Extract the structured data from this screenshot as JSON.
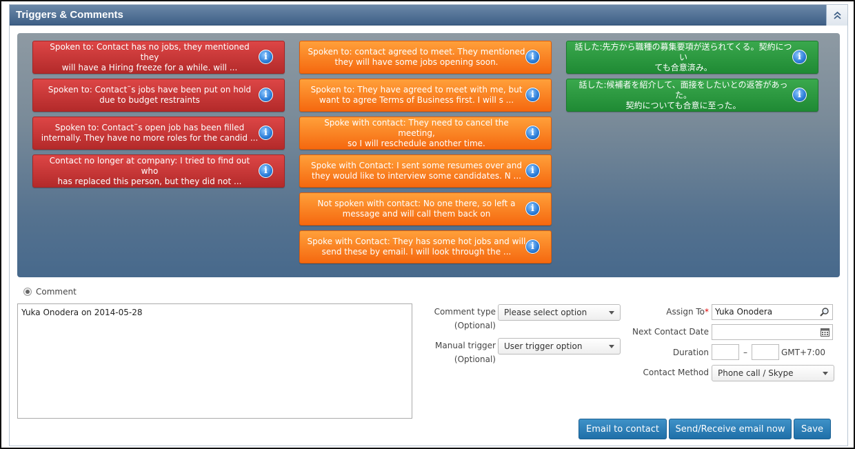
{
  "panel": {
    "title": "Triggers & Comments"
  },
  "triggers": {
    "col1": [
      "Spoken to: Contact has no jobs, they mentioned they\nwill have a Hiring freeze for a while. will ...",
      "Spoken to: Contact¨s jobs have been put on hold\ndue to budget restraints",
      "Spoken to: Contact¨s open job has been filled\ninternally. They have no more roles for the candid ...",
      "Contact no longer at company: I tried to find out who\nhas replaced this person, but they did not ..."
    ],
    "col2": [
      "Spoken to: contact agreed to meet. They mentioned\nthey will have some jobs opening soon.",
      "Spoken to: They have agreed to meet with me, but\nwant to agree Terms of Business first. I will s ...",
      "Spoke with contact: They need to cancel the meeting,\nso I will reschedule another time.",
      "Spoke with Contact: I sent some resumes over and\nthey would like to interview some candidates. N ...",
      "Not spoken with contact: No one there, so left a\nmessage and will call them back on",
      "Spoke with Contact: They has some hot jobs and will\nsend these by email. I will look through the ..."
    ],
    "col3": [
      "話した:先方から職種の募集要項が送られてくる。契約につい\nても合意済み。",
      "話した:候補者を紹介して、面接をしたいとの返答があった。\n契約についても合意に至った。"
    ],
    "info_glyph": "i"
  },
  "comment": {
    "radio_label": "Comment",
    "text": "Yuka Onodera on 2014-05-28"
  },
  "form": {
    "comment_type_label": "Comment type",
    "comment_type_optional": "(Optional)",
    "comment_type_value": "Please select option",
    "manual_trigger_label": "Manual trigger",
    "manual_trigger_optional": "(Optional)",
    "manual_trigger_value": "User trigger option",
    "assign_to_label": "Assign To",
    "assign_to_required": "*",
    "assign_to_value": "Yuka Onodera",
    "next_contact_label": "Next Contact Date",
    "next_contact_value": "",
    "duration_label": "Duration",
    "duration_sep": "–",
    "duration_tz": "GMT+7:00",
    "contact_method_label": "Contact Method",
    "contact_method_value": "Phone call / Skype"
  },
  "buttons": {
    "email_contact": "Email to contact",
    "send_receive": "Send/Receive email now",
    "save": "Save"
  },
  "colors": {
    "header": "#4a6a90",
    "red_trigger": "#c73535",
    "orange_trigger": "#f97f1f",
    "green_trigger": "#2a9a40",
    "button": "#2a7db8"
  }
}
